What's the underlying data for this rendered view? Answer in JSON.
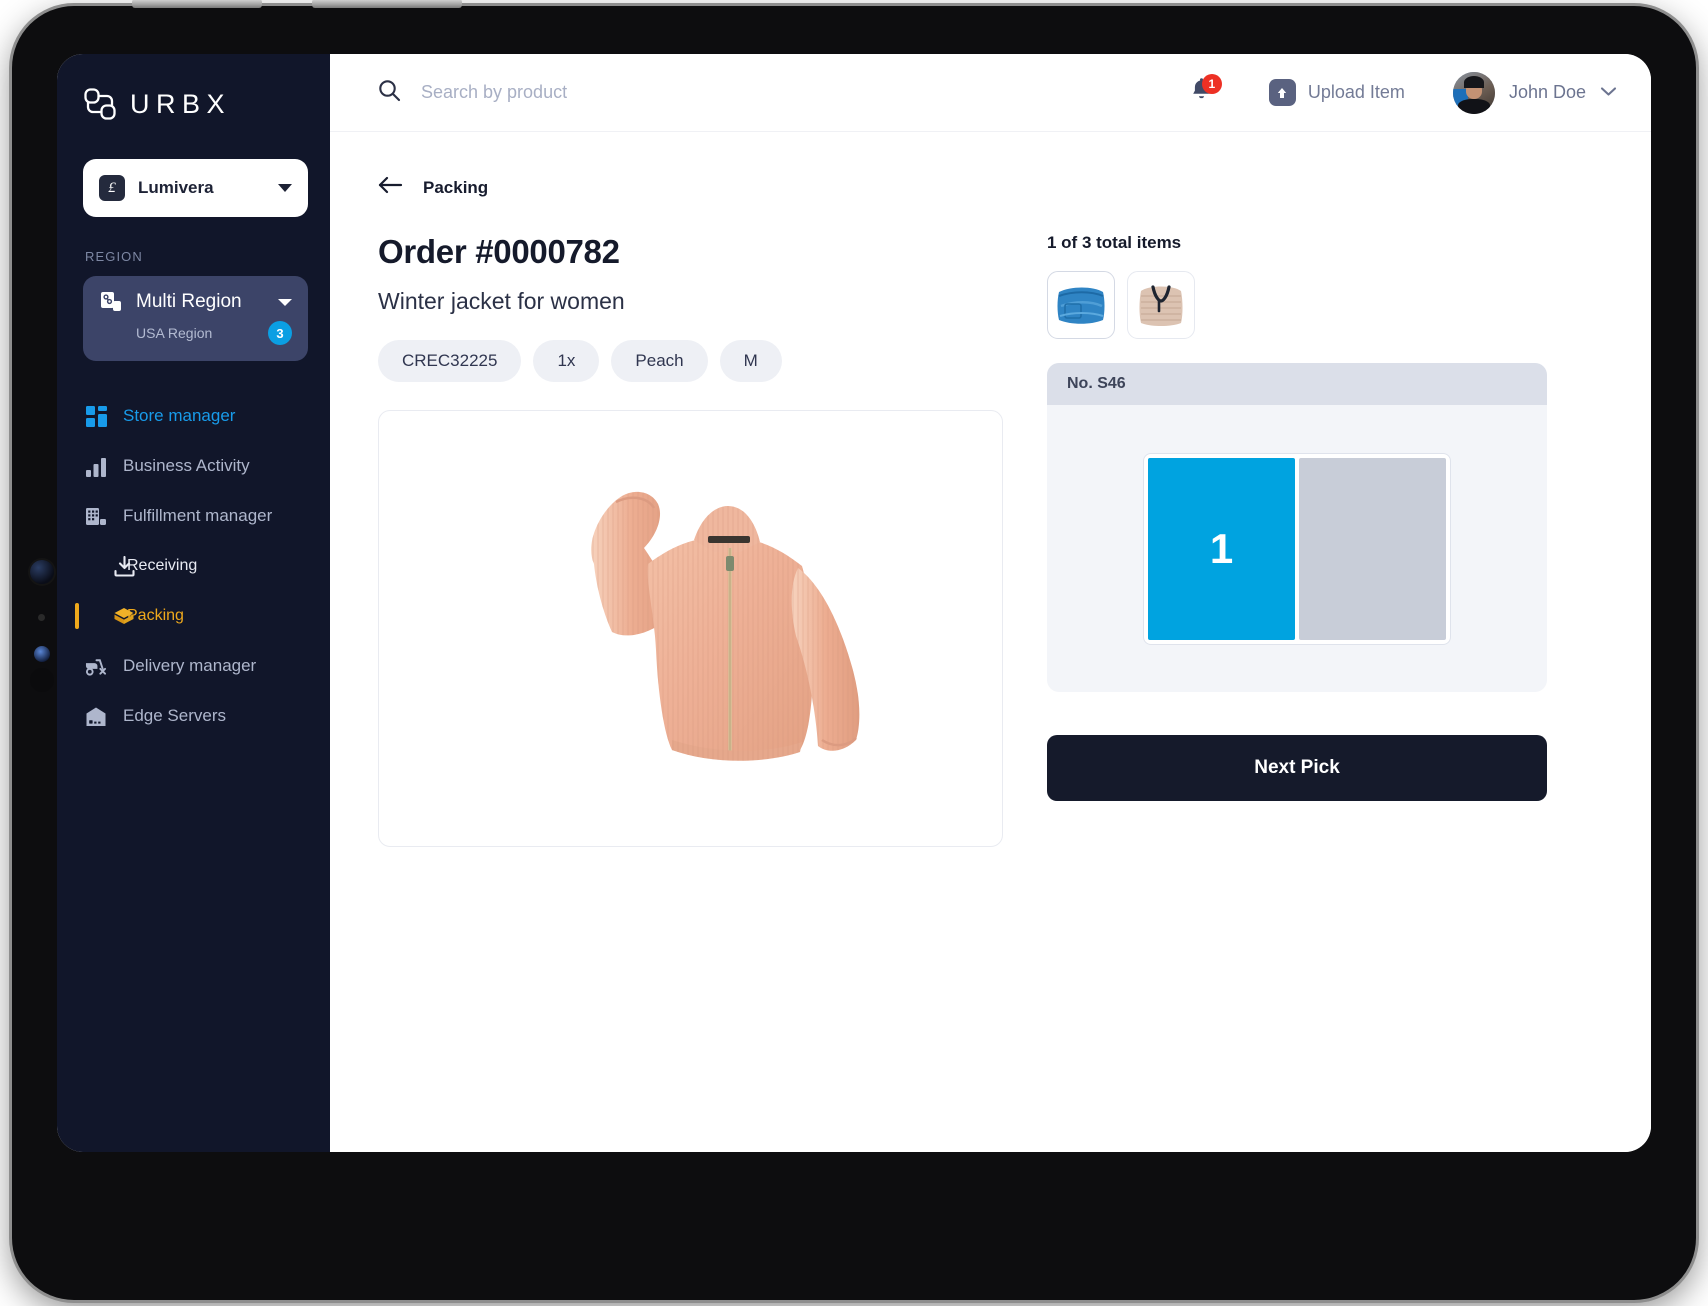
{
  "sidebar": {
    "brand": {
      "wordmark": "URBX",
      "logo_icon": "urbx-logo-icon"
    },
    "store_switcher": {
      "mark": "£",
      "name": "Lumivera",
      "caret_icon": "chevron-down-icon"
    },
    "region_section_label": "REGION",
    "region_card": {
      "name": "Multi Region",
      "sub": "USA Region",
      "badge": "3",
      "icon": "region-nodes-icon",
      "caret_icon": "chevron-down-icon"
    },
    "nav": [
      {
        "label": "Store manager",
        "icon": "grid-dashboard-icon",
        "state": "active-blue"
      },
      {
        "label": "Business Activity",
        "icon": "bar-chart-icon",
        "state": "default"
      },
      {
        "label": "Fulfillment manager",
        "icon": "warehouse-icon",
        "state": "default"
      },
      {
        "label": "Receiving",
        "icon": "inbox-download-icon",
        "state": "sub"
      },
      {
        "label": "Packing",
        "icon": "package-box-icon",
        "state": "active-gold"
      },
      {
        "label": "Delivery manager",
        "icon": "scooter-icon",
        "state": "default"
      },
      {
        "label": "Edge Servers",
        "icon": "server-building-icon",
        "state": "default"
      }
    ]
  },
  "topbar": {
    "search": {
      "placeholder": "Search by product",
      "value": "",
      "icon": "search-icon"
    },
    "notifications": {
      "count": "1",
      "icon": "bell-icon"
    },
    "upload": {
      "label": "Upload Item",
      "icon": "upload-arrow-icon"
    },
    "user": {
      "name": "John Doe",
      "avatar": "user-avatar",
      "caret_icon": "chevron-down-icon"
    }
  },
  "main": {
    "breadcrumb": {
      "back_icon": "arrow-left-icon",
      "label": "Packing"
    },
    "order_title": "Order #0000782",
    "product_name": "Winter jacket for women",
    "attributes": [
      {
        "label": "CREC32225"
      },
      {
        "label": "1x"
      },
      {
        "label": "Peach"
      },
      {
        "label": "M"
      }
    ],
    "product_image_alt": "peach-winter-jacket"
  },
  "picking": {
    "items_count": "1 of 3 total items",
    "thumbnails": [
      {
        "alt": "folded-blue-jeans",
        "selected": true
      },
      {
        "alt": "folded-striped-shirt",
        "selected": false
      }
    ],
    "bin": {
      "header": "No. S46",
      "cells": [
        {
          "label": "1",
          "active": true
        },
        {
          "label": "",
          "active": false
        }
      ]
    },
    "next_pick_label": "Next Pick"
  },
  "colors": {
    "sidebar_bg": "#11162a",
    "region_card_bg": "#3c4468",
    "accent_blue": "#189bea",
    "bin_blue": "#00a3e0",
    "accent_gold": "#efa91c",
    "badge_blue": "#0b9fe3",
    "notification_red": "#ed3024",
    "dark_button": "#151a2b"
  }
}
